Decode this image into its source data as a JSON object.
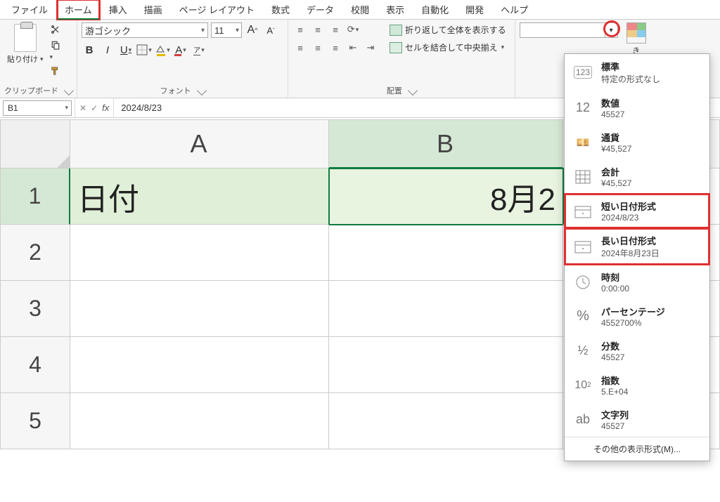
{
  "menu": {
    "file": "ファイル",
    "home": "ホーム",
    "insert": "挿入",
    "draw": "描画",
    "pageLayout": "ページ レイアウト",
    "formulas": "数式",
    "data": "データ",
    "review": "校閲",
    "view": "表示",
    "automate": "自動化",
    "developer": "開発",
    "help": "ヘルプ"
  },
  "ribbon": {
    "clipboard": {
      "paste": "貼り付け",
      "group": "クリップボード"
    },
    "font": {
      "name": "游ゴシック",
      "size": "11",
      "incA": "A",
      "decA": "A",
      "bold": "B",
      "italic": "I",
      "underline": "U",
      "ruby": "ア",
      "group": "フォント"
    },
    "align": {
      "wrap": "折り返して全体を表示する",
      "merge": "セルを結合して中央揃え",
      "group": "配置"
    },
    "number": {
      "selected": "",
      "condfmt": "き"
    }
  },
  "formulaBar": {
    "nameBox": "B1",
    "fx": "fx",
    "value": "2024/8/23"
  },
  "grid": {
    "colA": "A",
    "colB": "B",
    "row1": "1",
    "row2": "2",
    "row3": "3",
    "row4": "4",
    "row5": "5",
    "a1": "日付",
    "b1": "8月2"
  },
  "dropdown": {
    "items": [
      {
        "icon": "123",
        "title": "標準",
        "sample": "特定の形式なし"
      },
      {
        "icon": "12",
        "title": "数値",
        "sample": "45527"
      },
      {
        "icon": "¥",
        "title": "通貨",
        "sample": "¥45,527"
      },
      {
        "icon": "☷",
        "title": "会計",
        "sample": "¥45,527"
      },
      {
        "icon": "📅",
        "title": "短い日付形式",
        "sample": "2024/8/23"
      },
      {
        "icon": "📅",
        "title": "長い日付形式",
        "sample": "2024年8月23日"
      },
      {
        "icon": "◷",
        "title": "時刻",
        "sample": "0:00:00"
      },
      {
        "icon": "%",
        "title": "パーセンテージ",
        "sample": "4552700%"
      },
      {
        "icon": "½",
        "title": "分数",
        "sample": "45527"
      },
      {
        "icon": "10²",
        "title": "指数",
        "sample": "5.E+04"
      },
      {
        "icon": "ab",
        "title": "文字列",
        "sample": "45527"
      }
    ],
    "footer": "その他の表示形式(M)..."
  }
}
